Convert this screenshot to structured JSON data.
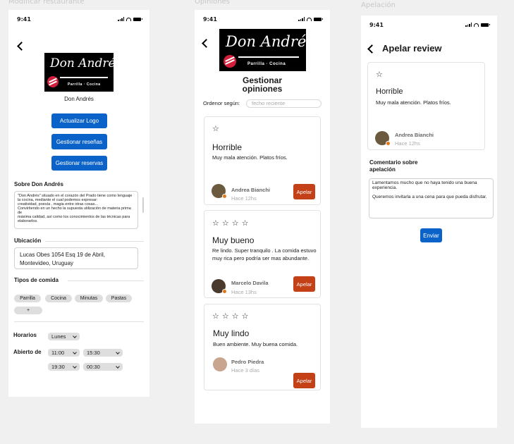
{
  "frames": {
    "modificar": "Modificar restaurante",
    "opiniones": "Opiniones",
    "apelacion": "Apelación"
  },
  "status": {
    "time": "9:41"
  },
  "logo": {
    "script": "Don Andrés",
    "sub": "Parrilla · Cocina"
  },
  "modificar": {
    "restaurant_name": "Don Andrés",
    "btn_logo": "Actualizar Logo",
    "btn_resenas": "Gestionar reseñas",
    "btn_reservas": "Gestionar reservas",
    "sobre_title": "Sobre Don Andrés",
    "sobre_text": "\"Don Andrés\" situado en el corazón del Prado tiene como lenguaje la cocina, mediante el cual podemos expresar:\ncreatividad, poesía , magia entre otras cosas...\nConvirtiendo en un hecho la supuesta utilización de materia prima de\nmáxima calidad, así como los conocimientos de las técnicas para elaborarlos.",
    "ubicacion_title": "Ubicación",
    "ubicacion_value": "Lucas Obes 1054 Esq 19 de Abril, Montevideo, Uruguay",
    "tipos_title": "Tipos de comida",
    "tipos": [
      "Parrilla",
      "Cocina",
      "Minutas",
      "Pastas"
    ],
    "add_chip": "+",
    "horarios_label": "Horarios",
    "horarios_day": "Lunes",
    "abierto_label": "Abierto de",
    "slot1_from": "11:00",
    "slot1_to": "15:30",
    "slot2_from": "19:30",
    "slot2_to": "00:30"
  },
  "opiniones": {
    "title": "Gestionar opiniones",
    "sort_label": "Ordenor según:",
    "sort_placeholder": "fecho reciente",
    "reviews": [
      {
        "stars": 1,
        "title": "Horrible",
        "text": "Muy mala atención. Platos fríos.",
        "name": "Andrea Bianchi",
        "time": "Hace 12hs",
        "action": "Apelar"
      },
      {
        "stars": 4,
        "title": "Muy bueno",
        "text": "Re lindo. Super tranquilo . La comida estuvo muy rica pero podría ser mas abundante.",
        "name": "Marcelo Davila",
        "time": "Hace 13hs",
        "action": "Apelar"
      },
      {
        "stars": 4,
        "title": "Muy lindo",
        "text": "Buen ambiente. Muy buena comida.",
        "name": "Pedro Piedra",
        "time": "Hace 3 días",
        "action": "Apelar"
      }
    ]
  },
  "apelacion": {
    "title": "Apelar review",
    "review": {
      "title": "Horrible",
      "text": "Muy mala atención. Platos fríos.",
      "name": "Andrea Bianchi",
      "time": "Hace 12hs"
    },
    "comment_title": "Comentario sobre apelación",
    "comment_text": "Lamentamos mucho que no haya tenido una buena experiencia.\n\nQueremos invitarla a una cena para que pueda disfrutar.",
    "send_button": "Enviar"
  },
  "colors": {
    "primary": "#0b63c9",
    "apelar": "#c44016",
    "badge": "#e0781a"
  }
}
